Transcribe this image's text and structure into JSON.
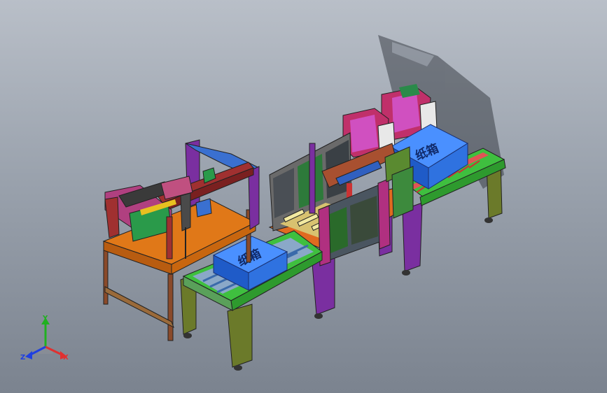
{
  "scene": {
    "boxes": [
      {
        "label": "纸箱"
      },
      {
        "label": "纸箱"
      }
    ]
  },
  "triad": {
    "x_label": "X",
    "y_label": "Y",
    "z_label": "Z",
    "colors": {
      "x": "#e03030",
      "y": "#20b020",
      "z": "#2040e0"
    }
  }
}
